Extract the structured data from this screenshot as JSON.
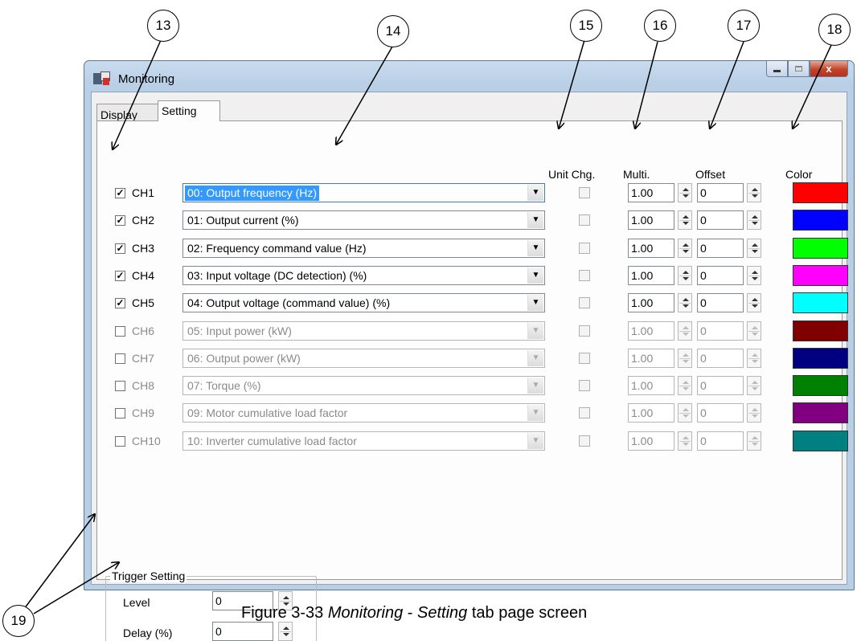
{
  "window": {
    "title": "Monitoring",
    "controls": [
      "minimize",
      "maximize",
      "close"
    ],
    "close_label": "x"
  },
  "tabs": [
    {
      "label": "Display",
      "active": false
    },
    {
      "label": "Setting",
      "active": true
    }
  ],
  "columns": {
    "unit_chg": "Unit Chg.",
    "multi": "Multi.",
    "offset": "Offset",
    "color": "Color"
  },
  "channels": [
    {
      "checked": true,
      "name": "CH1",
      "item": "00: Output frequency (Hz)",
      "unit_chg": false,
      "multi": "1.00",
      "offset": "0",
      "color": "#ff0000",
      "enabled": true,
      "selected": true
    },
    {
      "checked": true,
      "name": "CH2",
      "item": "01: Output current (%)",
      "unit_chg": false,
      "multi": "1.00",
      "offset": "0",
      "color": "#0000ff",
      "enabled": true
    },
    {
      "checked": true,
      "name": "CH3",
      "item": "02: Frequency command value (Hz)",
      "unit_chg": false,
      "multi": "1.00",
      "offset": "0",
      "color": "#00ff00",
      "enabled": true
    },
    {
      "checked": true,
      "name": "CH4",
      "item": "03: Input voltage (DC detection) (%)",
      "unit_chg": false,
      "multi": "1.00",
      "offset": "0",
      "color": "#ff00ff",
      "enabled": true
    },
    {
      "checked": true,
      "name": "CH5",
      "item": "04: Output voltage (command value) (%)",
      "unit_chg": false,
      "multi": "1.00",
      "offset": "0",
      "color": "#00ffff",
      "enabled": true
    },
    {
      "checked": false,
      "name": "CH6",
      "item": "05: Input power (kW)",
      "unit_chg": false,
      "multi": "1.00",
      "offset": "0",
      "color": "#800000",
      "enabled": false
    },
    {
      "checked": false,
      "name": "CH7",
      "item": "06: Output power (kW)",
      "unit_chg": false,
      "multi": "1.00",
      "offset": "0",
      "color": "#000080",
      "enabled": false
    },
    {
      "checked": false,
      "name": "CH8",
      "item": "07: Torque (%)",
      "unit_chg": false,
      "multi": "1.00",
      "offset": "0",
      "color": "#008000",
      "enabled": false
    },
    {
      "checked": false,
      "name": "CH9",
      "item": "09: Motor cumulative load factor",
      "unit_chg": false,
      "multi": "1.00",
      "offset": "0",
      "color": "#800080",
      "enabled": false
    },
    {
      "checked": false,
      "name": "CH10",
      "item": "10: Inverter cumulative load factor",
      "unit_chg": false,
      "multi": "1.00",
      "offset": "0",
      "color": "#008080",
      "enabled": false
    }
  ],
  "trigger": {
    "title": "Trigger Setting",
    "level_label": "Level",
    "level_value": "0",
    "delay_label": "Delay (%)",
    "delay_value": "0"
  },
  "callouts": [
    "13",
    "14",
    "15",
    "16",
    "17",
    "18",
    "19"
  ],
  "caption": {
    "prefix": "Figure 3-33 ",
    "italic1": "Monitoring",
    "mid": " - ",
    "italic2": "Setting",
    "suffix": " tab page screen"
  }
}
